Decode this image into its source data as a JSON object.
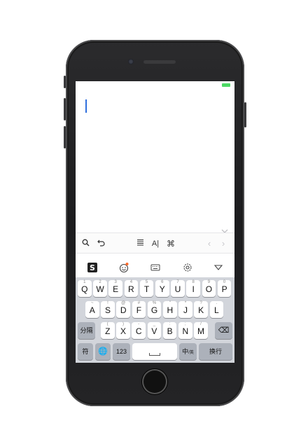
{
  "toolbar": {
    "font_icon_glyph": "A|",
    "cmd_icon_glyph": "⌘",
    "prev_glyph": "‹",
    "next_glyph": "›"
  },
  "keyboard": {
    "row1": [
      {
        "main": "Q",
        "sub": "1"
      },
      {
        "main": "W",
        "sub": "2"
      },
      {
        "main": "E",
        "sub": "3"
      },
      {
        "main": "R",
        "sub": "4"
      },
      {
        "main": "T",
        "sub": "5"
      },
      {
        "main": "Y",
        "sub": "6"
      },
      {
        "main": "U",
        "sub": "7"
      },
      {
        "main": "I",
        "sub": "8"
      },
      {
        "main": "O",
        "sub": "9"
      },
      {
        "main": "P",
        "sub": "0"
      }
    ],
    "row2": [
      {
        "main": "A",
        "sub": "~"
      },
      {
        "main": "S",
        "sub": "!"
      },
      {
        "main": "D",
        "sub": "@"
      },
      {
        "main": "F",
        "sub": "#"
      },
      {
        "main": "G",
        "sub": "%"
      },
      {
        "main": "H",
        "sub": "\""
      },
      {
        "main": "J",
        "sub": "*"
      },
      {
        "main": "K",
        "sub": "?"
      },
      {
        "main": "L",
        "sub": "."
      }
    ],
    "row3": [
      {
        "main": "Z",
        "sub": "("
      },
      {
        "main": "X",
        "sub": ")"
      },
      {
        "main": "C",
        "sub": "-"
      },
      {
        "main": "V",
        "sub": "_"
      },
      {
        "main": "B",
        "sub": ":"
      },
      {
        "main": "N",
        "sub": ";"
      },
      {
        "main": "M",
        "sub": "/"
      }
    ],
    "split_label": "分隔",
    "delete_glyph": "⌫",
    "symbol_label": "符",
    "globe_glyph": "🌐",
    "numbers_label": "123",
    "lang_label": "中",
    "lang_sub": "/英",
    "return_label": "换行"
  },
  "colors": {
    "cursor": "#2f6fdd",
    "battery": "#4cd964",
    "keyboard_bg": "#d2d5db",
    "function_key": "#acb1ba"
  }
}
